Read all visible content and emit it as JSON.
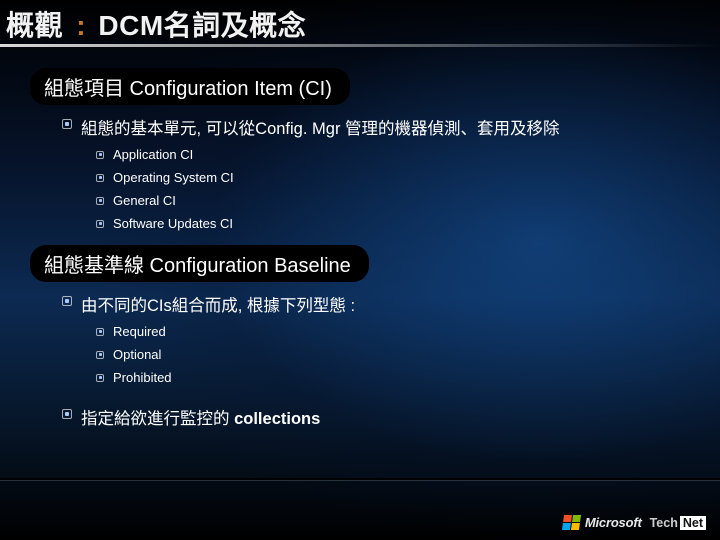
{
  "title": {
    "pre": "概觀",
    "colon": ":",
    "post": "DCM名詞及概念"
  },
  "section1": {
    "heading": "組態項目 Configuration Item (CI)",
    "lead": "組態的基本單元, 可以從Config. Mgr 管理的機器偵測、套用及移除",
    "items": [
      "Application CI",
      "Operating System CI",
      "General CI",
      "Software Updates CI"
    ]
  },
  "section2": {
    "heading": "組態基準線 Configuration Baseline",
    "lead": "由不同的CIs組合而成, 根據下列型態 :",
    "items": [
      "Required",
      "Optional",
      "Prohibited"
    ],
    "tail_pre": "指定給欲進行監控的 ",
    "tail_bold": "collections"
  },
  "brand": {
    "microsoft": "Microsoft",
    "tech": "Tech",
    "net": "Net"
  }
}
